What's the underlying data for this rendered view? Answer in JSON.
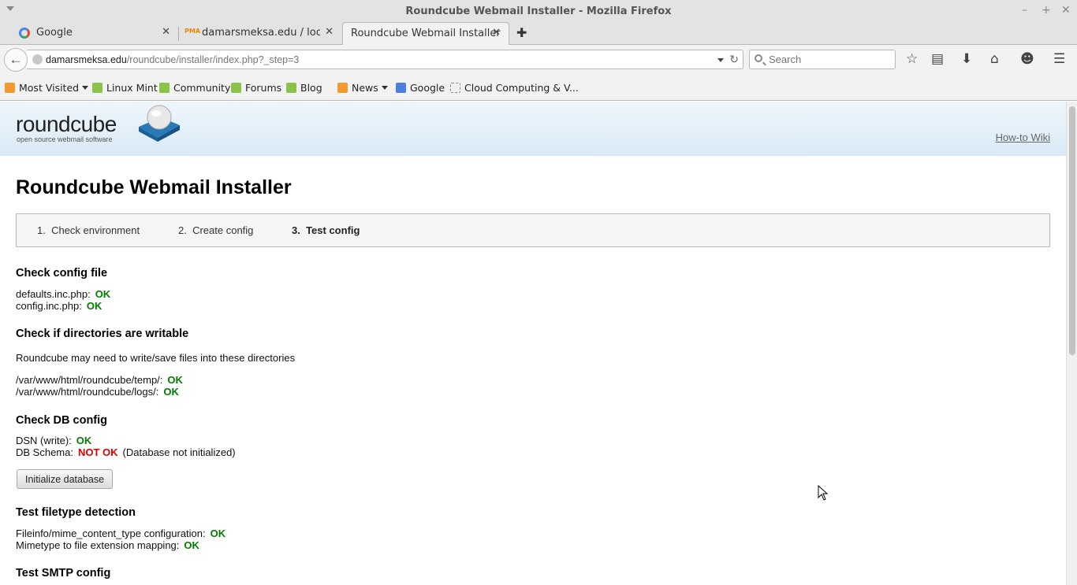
{
  "window": {
    "title": "Roundcube Webmail Installer - Mozilla Firefox"
  },
  "tabs": [
    {
      "label": "Google"
    },
    {
      "label": "damarsmeksa.edu / local..."
    },
    {
      "label": "Roundcube Webmail Installer"
    }
  ],
  "navbar": {
    "url_host": "damarsmeksa.edu",
    "url_path": "/roundcube/installer/index.php?_step=3",
    "search_placeholder": "Search"
  },
  "bookmarks": [
    {
      "label": "Most Visited",
      "icon": "rss-icon"
    },
    {
      "label": "Linux Mint",
      "icon": "mint-icon"
    },
    {
      "label": "Community",
      "icon": "mint-icon"
    },
    {
      "label": "Forums",
      "icon": "mint-icon"
    },
    {
      "label": "Blog",
      "icon": "mint-icon"
    },
    {
      "label": "News",
      "icon": "rss-icon"
    },
    {
      "label": "Google",
      "icon": "google-icon"
    },
    {
      "label": "Cloud Computing & V...",
      "icon": "page-icon"
    }
  ],
  "page": {
    "logo_text": "roundcube",
    "logo_sub": "open source webmail software",
    "howto": "How-to Wiki",
    "title": "Roundcube Webmail Installer",
    "steps": [
      {
        "num": "1.",
        "label": "Check environment"
      },
      {
        "num": "2.",
        "label": "Create config"
      },
      {
        "num": "3.",
        "label": "Test config"
      }
    ],
    "config_file": {
      "heading": "Check config file",
      "items": [
        {
          "label": "defaults.inc.php:",
          "status": "OK"
        },
        {
          "label": "config.inc.php:",
          "status": "OK"
        }
      ]
    },
    "dirs": {
      "heading": "Check if directories are writable",
      "intro": "Roundcube may need to write/save files into these directories",
      "items": [
        {
          "label": "/var/www/html/roundcube/temp/:",
          "status": "OK"
        },
        {
          "label": "/var/www/html/roundcube/logs/:",
          "status": "OK"
        }
      ]
    },
    "db": {
      "heading": "Check DB config",
      "dsn_label": "DSN (write):",
      "dsn_status": "OK",
      "schema_label": "DB Schema:",
      "schema_status": "NOT OK",
      "schema_note": "(Database not initialized)",
      "init_button": "Initialize database"
    },
    "filetype": {
      "heading": "Test filetype detection",
      "items": [
        {
          "label": "Fileinfo/mime_content_type configuration:",
          "status": "OK"
        },
        {
          "label": "Mimetype to file extension mapping:",
          "status": "OK"
        }
      ]
    },
    "smtp": {
      "heading": "Test SMTP config"
    }
  },
  "colors": {
    "ok": "#007c00",
    "not_ok": "#e00000",
    "banner": "#daeaf6"
  }
}
